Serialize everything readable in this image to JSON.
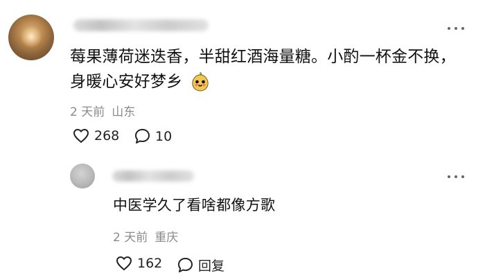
{
  "comments": [
    {
      "text": "莓果薄荷迷迭香，半甜红酒海量糖。小酌一杯金不换，身暖心安好梦乡",
      "meta": {
        "time": "2 天前",
        "location": "山东"
      },
      "actions": {
        "likes": "268",
        "comments": "10"
      }
    }
  ],
  "reply": {
    "text": "中医学久了看啥都像方歌",
    "meta": {
      "time": "2 天前",
      "location": "重庆"
    },
    "actions": {
      "likes": "162",
      "reply_label": "回复"
    }
  },
  "icons": {
    "more": "more-horizontal-icon",
    "like": "heart-icon",
    "comment": "comment-bubble-icon",
    "emoji": "pear-face-emoji-icon"
  },
  "colors": {
    "text": "#111111",
    "meta": "#8a8a8a",
    "icon": "#222222"
  }
}
